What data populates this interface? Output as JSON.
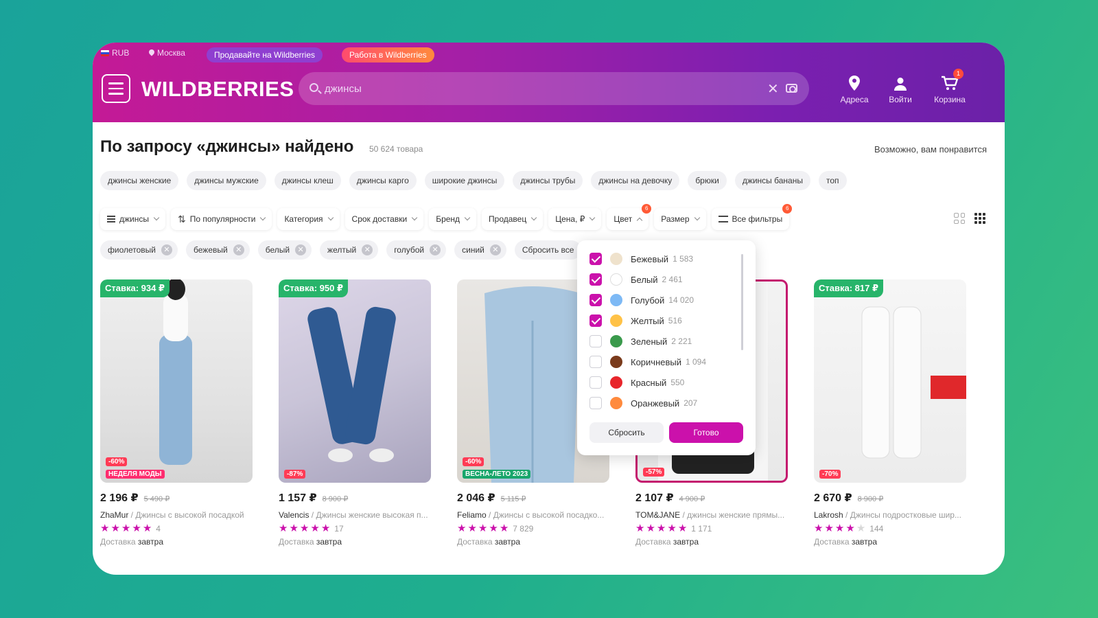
{
  "topbar": {
    "currency": "RUB",
    "city": "Москва",
    "sell_label": "Продавайте на Wildberries",
    "work_label": "Работа в Wildberries"
  },
  "header": {
    "logo": "WILDBERRIES",
    "search_value": "джинсы",
    "addresses_label": "Адреса",
    "login_label": "Войти",
    "cart_label": "Корзина",
    "cart_count": "1"
  },
  "results": {
    "title": "По запросу «джинсы» найдено",
    "count": "50 624 товара",
    "maybe_like": "Возможно, вам понравится"
  },
  "suggestions": [
    "джинсы женские",
    "джинсы мужские",
    "джинсы клеш",
    "джинсы карго",
    "широкие джинсы",
    "джинсы трубы",
    "джинсы на девочку",
    "брюки",
    "джинсы бананы",
    "топ"
  ],
  "filters": {
    "query": "джинсы",
    "sort": "По популярности",
    "category": "Категория",
    "delivery": "Срок доставки",
    "brand": "Бренд",
    "seller": "Продавец",
    "price": "Цена, ₽",
    "color": "Цвет",
    "color_badge": "6",
    "size": "Размер",
    "all": "Все фильтры",
    "all_badge": "6"
  },
  "selected_filters": [
    "фиолетовый",
    "бежевый",
    "белый",
    "желтый",
    "голубой",
    "синий"
  ],
  "reset_all_label": "Сбросить все",
  "color_dropdown": {
    "options": [
      {
        "name": "Бежевый",
        "count": "1 583",
        "checked": true,
        "color": "#efe2cc"
      },
      {
        "name": "Белый",
        "count": "2 461",
        "checked": true,
        "color": "#ffffff"
      },
      {
        "name": "Голубой",
        "count": "14 020",
        "checked": true,
        "color": "#7db9f5"
      },
      {
        "name": "Желтый",
        "count": "516",
        "checked": true,
        "color": "#ffc247"
      },
      {
        "name": "Зеленый",
        "count": "2 221",
        "checked": false,
        "color": "#3a9a4c"
      },
      {
        "name": "Коричневый",
        "count": "1 094",
        "checked": false,
        "color": "#7a3b1c"
      },
      {
        "name": "Красный",
        "count": "550",
        "checked": false,
        "color": "#e8262b"
      },
      {
        "name": "Оранжевый",
        "count": "207",
        "checked": false,
        "color": "#ff8a3d"
      }
    ],
    "reset_label": "Сбросить",
    "done_label": "Готово"
  },
  "products": [
    {
      "bid": "Ставка: 934 ₽",
      "discount": "-60%",
      "promo": "НЕДЕЛЯ МОДЫ",
      "price": "2 196 ₽",
      "old_price": "5 490 ₽",
      "brand": "ZhaMur",
      "title": " / Джинсы с высокой посадкой",
      "stars": 5,
      "reviews": "4",
      "delivery_prefix": "Доставка ",
      "delivery_day": "завтра"
    },
    {
      "bid": "Ставка: 950 ₽",
      "discount": "-87%",
      "promo": "",
      "price": "1 157 ₽",
      "old_price": "8 900 ₽",
      "brand": "Valencis",
      "title": " / Джинсы женские высокая п...",
      "stars": 5,
      "reviews": "17",
      "delivery_prefix": "Доставка ",
      "delivery_day": "завтра"
    },
    {
      "bid": "",
      "discount": "-60%",
      "promo": "ВЕСНА-ЛЕТО 2023",
      "price": "2 046 ₽",
      "old_price": "5 115 ₽",
      "brand": "Feliamo",
      "title": " / Джинсы с высокой посадко...",
      "stars": 5,
      "reviews": "7 829",
      "delivery_prefix": "Доставка ",
      "delivery_day": "завтра"
    },
    {
      "bid": "",
      "discount": "-57%",
      "promo": "",
      "price": "2 107 ₽",
      "old_price": "4 900 ₽",
      "brand": "TOM&JANE",
      "title": " / джинсы женские прямы...",
      "stars": 5,
      "reviews": "1 171",
      "delivery_prefix": "Доставка ",
      "delivery_day": "завтра"
    },
    {
      "bid": "Ставка: 817 ₽",
      "discount": "-70%",
      "promo": "",
      "price": "2 670 ₽",
      "old_price": "8 900 ₽",
      "brand": "Lakrosh",
      "title": " / Джинсы подростковые шир...",
      "stars": 4,
      "reviews": "144",
      "delivery_prefix": "Доставка ",
      "delivery_day": "завтра"
    }
  ],
  "colors": {
    "brand": "#cb11ab",
    "bid": "#27b46a",
    "discount": "#ff3b55"
  }
}
